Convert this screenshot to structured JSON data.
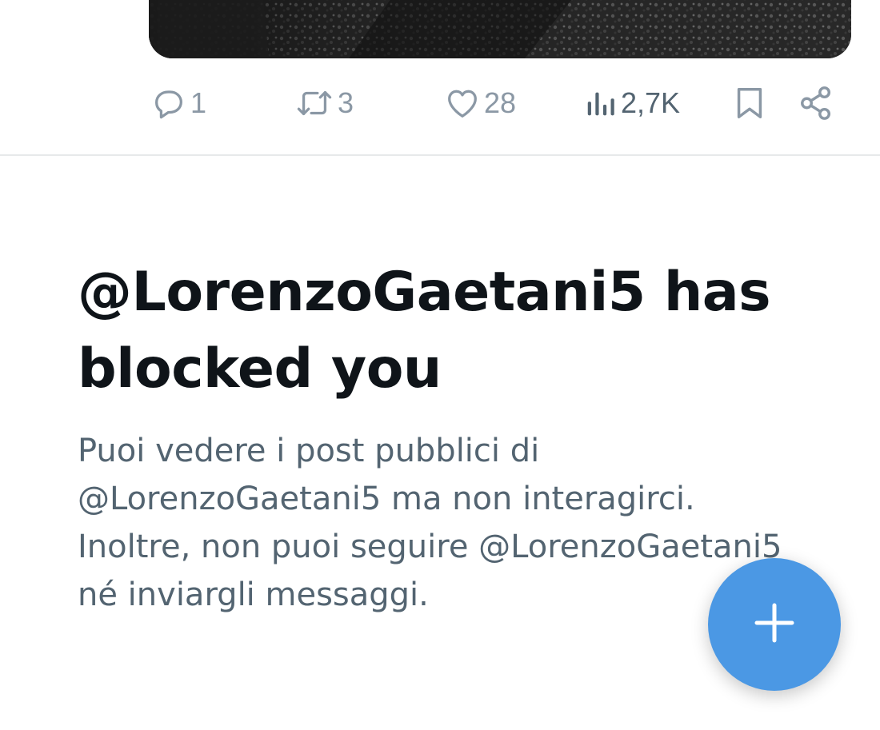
{
  "tweet": {
    "media": {
      "description_icon": "photo-dark-gravel"
    },
    "actions": {
      "reply": {
        "icon": "reply-bubble-icon",
        "count": "1"
      },
      "repost": {
        "icon": "repost-icon",
        "count": "3"
      },
      "like": {
        "icon": "heart-icon",
        "count": "28"
      },
      "views": {
        "icon": "views-bars-icon",
        "count": "2,7K"
      },
      "bookmark": {
        "icon": "bookmark-icon"
      },
      "share": {
        "icon": "share-icon"
      }
    }
  },
  "blocked": {
    "title": "@LorenzoGaetani5 has blocked you",
    "description": "Puoi vedere i post pubblici di @LorenzoGaetani5 ma non interagirci. Inoltre, non puoi seguire @LorenzoGaetani5 né inviargli messaggi."
  },
  "fab": {
    "icon": "plus-icon"
  },
  "colors": {
    "accent": "#4b98e4",
    "text_primary": "#0f1419",
    "text_secondary": "#536471",
    "icon_muted": "#8b98a5",
    "divider": "#e7e9ea"
  }
}
